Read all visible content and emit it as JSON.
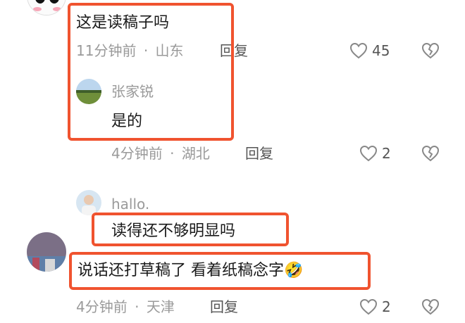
{
  "comments": [
    {
      "text": "这是读稿子吗",
      "time": "11分钟前",
      "location": "山东",
      "reply_label": "回复",
      "likes": "45"
    },
    {
      "username": "张家锐",
      "text": "是的",
      "time": "4分钟前",
      "location": "湖北",
      "reply_label": "回复",
      "likes": "2"
    },
    {
      "username": "hallo.",
      "text": "读得还不够明显吗"
    },
    {
      "text": "说话还打草稿了 看着纸稿念字",
      "emoji": "🤣",
      "time": "4分钟前",
      "location": "天津",
      "reply_label": "回复",
      "likes": "2"
    }
  ],
  "separator": "·",
  "icons": {
    "like": "heart-outline-icon",
    "dislike": "broken-heart-icon"
  },
  "colors": {
    "highlight": "#f0532f",
    "meta": "#9a9a9a",
    "text": "#1a1a1a"
  }
}
